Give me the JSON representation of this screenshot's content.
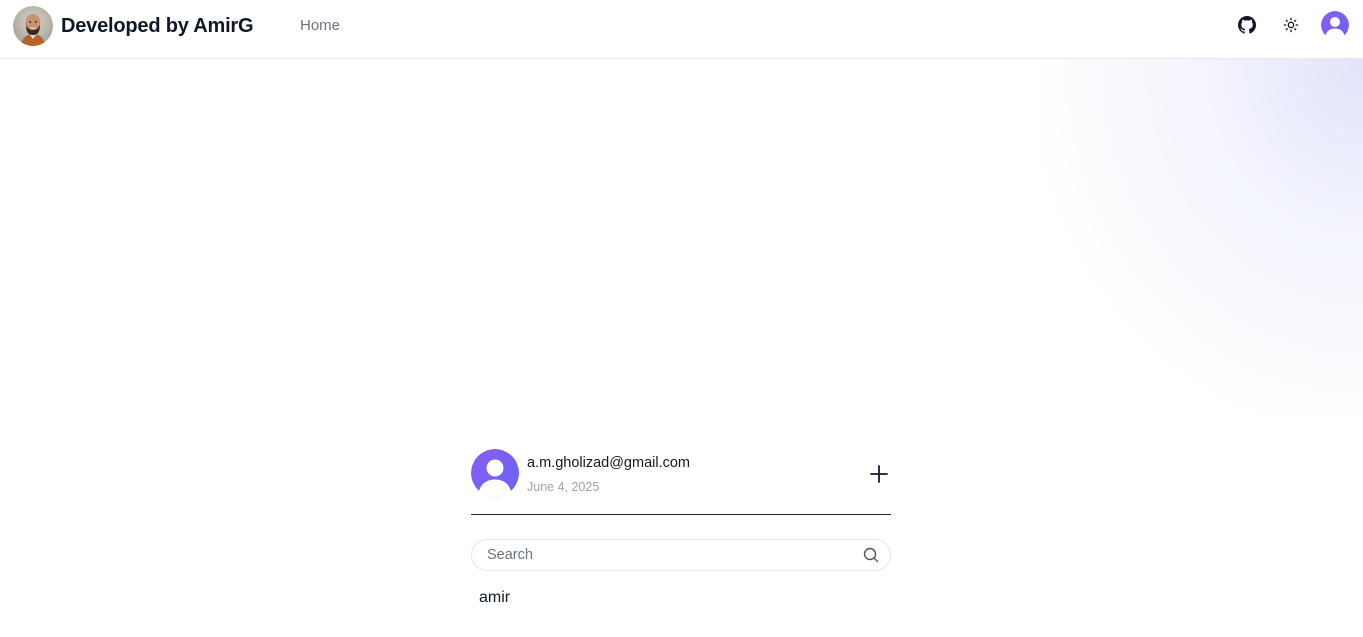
{
  "header": {
    "title": "Developed by AmirG",
    "nav": {
      "home_label": "Home"
    },
    "actions": [
      {
        "name": "github-icon"
      },
      {
        "name": "sun-icon"
      },
      {
        "name": "user-avatar"
      }
    ]
  },
  "profile": {
    "email": "a.m.gholizad@gmail.com",
    "date": "June 4, 2025"
  },
  "search": {
    "placeholder": "Search",
    "value": ""
  },
  "conversations": [
    {
      "label": "amir"
    }
  ],
  "colors": {
    "accent": "#6d4aff",
    "avatar_gradient": [
      "#8b5cf6",
      "#6366f1"
    ],
    "text_primary": "#111827",
    "text_muted": "#6b7280",
    "border": "#e5e7eb"
  }
}
